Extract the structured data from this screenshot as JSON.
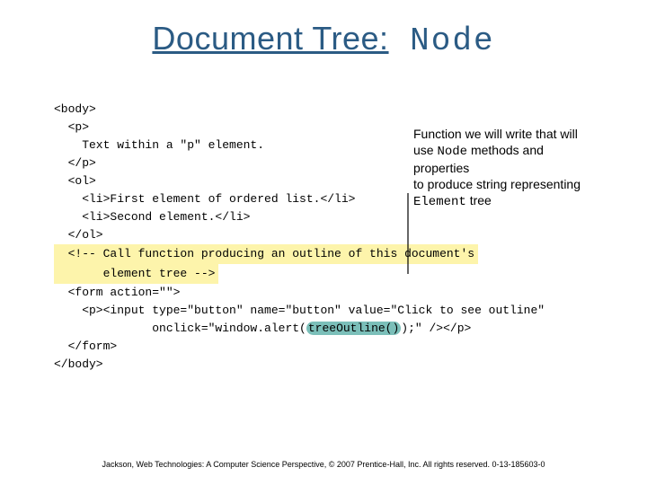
{
  "title": {
    "prefix": "Document Tree:",
    "node": " Node"
  },
  "callout": {
    "l1": "Function we will write that will",
    "l2_pre": "use ",
    "l2_mono": "Node",
    "l2_post": " methods and",
    "l3": "properties",
    "l4": "to produce string representing",
    "l5_mono": "Element",
    "l5_post": " tree"
  },
  "code": {
    "l01": "<body>",
    "l02": "  <p>",
    "l03": "    Text within a \"p\" element.",
    "l04": "  </p>",
    "l05": "  <ol>",
    "l06": "    <li>First element of ordered list.</li>",
    "l07": "    <li>Second element.</li>",
    "l08": "  </ol>",
    "l09a": "  <!-- Call function producing an outline of this document's",
    "l09b": "       element tree -->",
    "l10": "  <form action=\"\">",
    "l11a": "    <p><input type=\"button\" name=\"button\" value=\"Click to see outline\"",
    "l11b_pre": "              onclick=\"window.alert(",
    "l11b_hl": "treeOutline()",
    "l11b_post": ");\" /></p>",
    "l12": "  </form>",
    "l13": "</body>"
  },
  "footer": "Jackson, Web Technologies: A Computer Science Perspective, © 2007 Prentice-Hall, Inc. All rights reserved. 0-13-185603-0"
}
